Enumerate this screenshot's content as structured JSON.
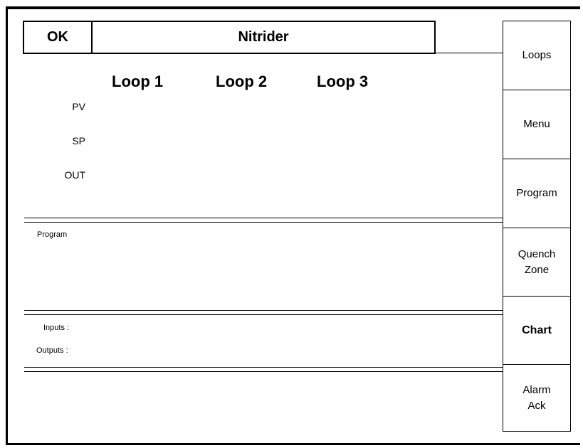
{
  "header": {
    "ok_label": "OK",
    "title": "Nitrider"
  },
  "loops": {
    "headings": [
      "Loop 1",
      "Loop 2",
      "Loop 3"
    ],
    "row_labels": [
      "PV",
      "SP",
      "OUT"
    ]
  },
  "program_section": {
    "label": "Program"
  },
  "io_section": {
    "inputs_label": "Inputs :",
    "outputs_label": "Outputs :"
  },
  "side_menu": {
    "items": [
      {
        "label": "Loops"
      },
      {
        "label": "Menu"
      },
      {
        "label": "Program"
      },
      {
        "label": "Quench\nZone"
      },
      {
        "label": "Chart"
      },
      {
        "label": "Alarm\nAck"
      }
    ]
  }
}
